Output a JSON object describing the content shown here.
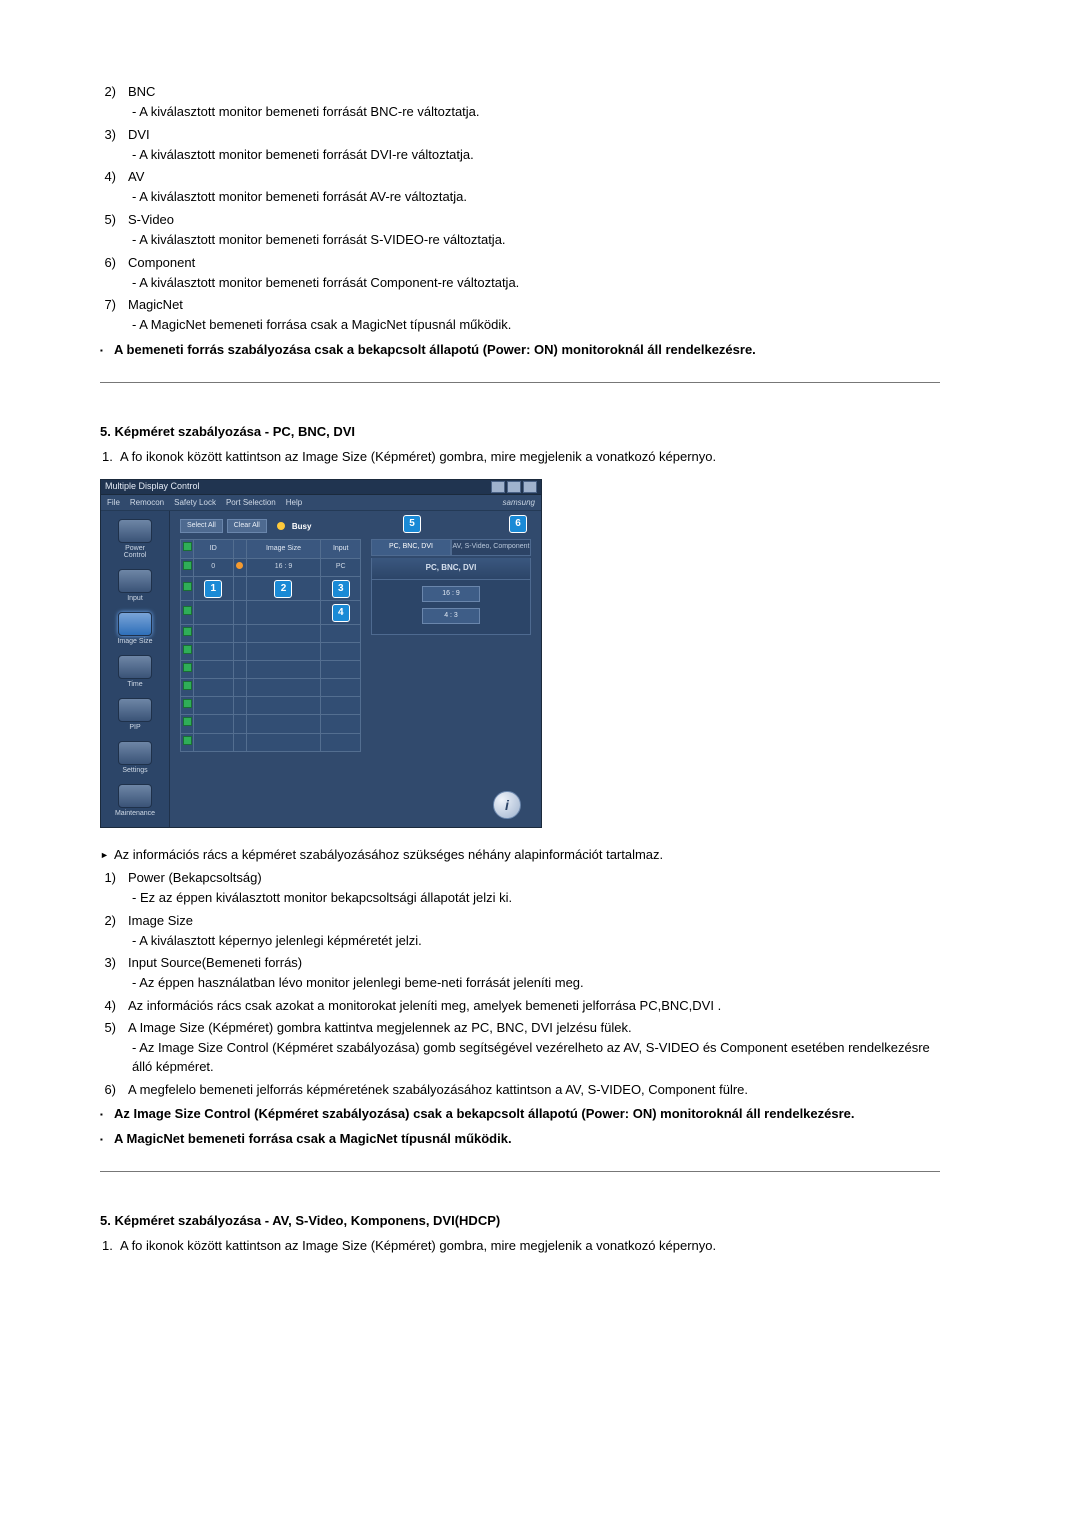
{
  "section1": {
    "items": [
      {
        "n": "2",
        "label": "BNC",
        "desc": "- A kiválasztott monitor bemeneti forrását BNC-re változtatja."
      },
      {
        "n": "3",
        "label": "DVI",
        "desc": "- A kiválasztott monitor bemeneti forrását DVI-re változtatja."
      },
      {
        "n": "4",
        "label": "AV",
        "desc": "- A kiválasztott monitor bemeneti forrását AV-re változtatja."
      },
      {
        "n": "5",
        "label": "S-Video",
        "desc": "- A kiválasztott monitor bemeneti forrását S-VIDEO-re változtatja."
      },
      {
        "n": "6",
        "label": "Component",
        "desc": "- A kiválasztott monitor bemeneti forrását Component-re változtatja."
      },
      {
        "n": "7",
        "label": "MagicNet",
        "desc": "- A MagicNet bemeneti forrása csak a MagicNet típusnál működik."
      }
    ],
    "note": "A bemeneti forrás szabályozása csak a bekapcsolt állapotú (Power: ON) monitoroknál áll rendelkezésre."
  },
  "section2": {
    "title": "5. Képméret szabályozása - PC, BNC, DVI",
    "intro_n": "1.",
    "intro": "A fo ikonok között kattintson az Image Size (Képméret) gombra, mire megjelenik a vonatkozó képernyo.",
    "figure": {
      "window_title": "Multiple Display Control",
      "menus": [
        "File",
        "Remocon",
        "Safety Lock",
        "Port Selection",
        "Help"
      ],
      "brand": "samsung",
      "toolbar": {
        "select_all": "Select All",
        "clear_all": "Clear All",
        "busy": "Busy"
      },
      "sidebar": [
        "Power Control",
        "Input",
        "Image Size",
        "Time",
        "PIP",
        "Settings",
        "Maintenance"
      ],
      "sidebar_active_index": 2,
      "grid": {
        "headers": [
          "",
          "ID",
          "",
          "Image Size",
          "Input"
        ],
        "row": {
          "id": "0",
          "size": "16 : 9",
          "input": "PC"
        }
      },
      "badges": {
        "b1": "1",
        "b2": "2",
        "b3": "3",
        "b4": "4",
        "b5": "5",
        "b6": "6"
      },
      "tabs": {
        "left": "PC, BNC, DVI",
        "right": "AV, S-Video, Component"
      },
      "panel_head": "PC, BNC, DVI",
      "ratios": [
        "16 : 9",
        "4 : 3"
      ],
      "info_glyph": "i"
    },
    "info_line": "Az információs rács a képméret szabályozásához szükséges néhány alapinformációt tartalmaz.",
    "items": [
      {
        "n": "1",
        "label": "Power (Bekapcsoltság)",
        "desc": "- Ez az éppen kiválasztott monitor bekapcsoltsági állapotát jelzi ki."
      },
      {
        "n": "2",
        "label": "Image Size",
        "desc": "- A kiválasztott képernyo jelenlegi képméretét jelzi."
      },
      {
        "n": "3",
        "label": "Input Source(Bemeneti forrás)",
        "desc": "- Az éppen használatban lévo monitor jelenlegi beme-neti forrását jeleníti meg."
      },
      {
        "n": "4",
        "label": "Az információs rács csak azokat a monitorokat jeleníti meg, amelyek bemeneti jelforrása PC,BNC,DVI ."
      },
      {
        "n": "5",
        "label": "A Image Size (Képméret) gombra kattintva megjelennek az PC, BNC, DVI jelzésu fülek.",
        "desc": "- Az Image Size Control (Képméret szabályozása) gomb segítségével vezérelheto az AV, S-VIDEO és Component esetében rendelkezésre álló képméret."
      },
      {
        "n": "6",
        "label": "A megfelelo bemeneti jelforrás képméretének szabályozásához kattintson a AV, S-VIDEO, Component fülre."
      }
    ],
    "notes": [
      "Az Image Size Control (Képméret szabályozása) csak a bekapcsolt állapotú (Power: ON) monitoroknál áll rendelkezésre.",
      "A MagicNet bemeneti forrása csak a MagicNet típusnál működik."
    ]
  },
  "section3": {
    "title": "5. Képméret szabályozása - AV, S-Video, Komponens, DVI(HDCP)",
    "intro_n": "1.",
    "intro": "A fo ikonok között kattintson az Image Size (Képméret) gombra, mire megjelenik a vonatkozó képernyo."
  }
}
